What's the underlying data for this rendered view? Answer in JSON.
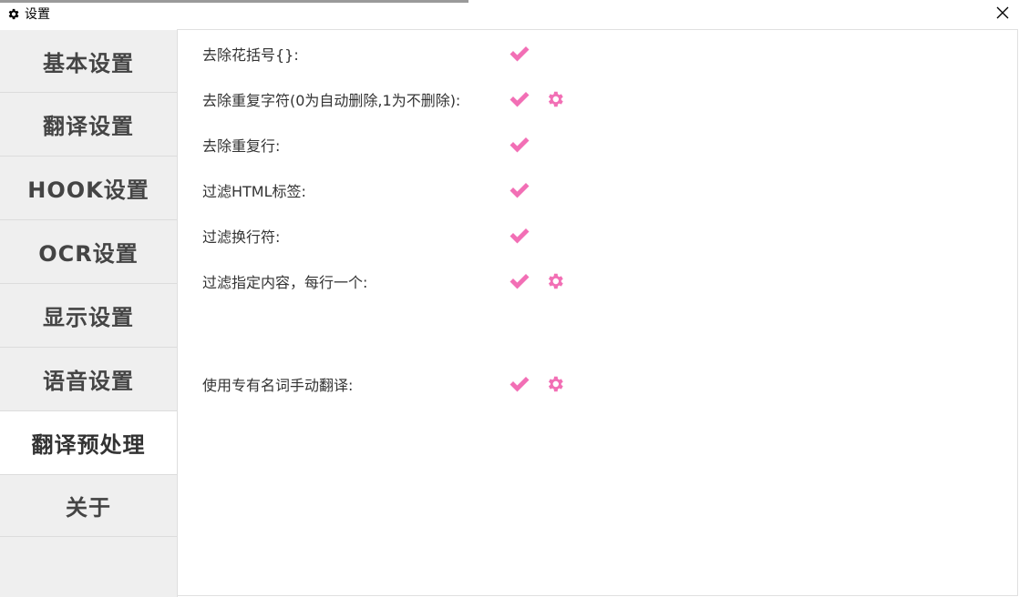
{
  "window": {
    "title": "设置",
    "title_icon": "gear-icon",
    "close_icon": "close-icon"
  },
  "sidebar": {
    "items": [
      {
        "label": "基本设置",
        "active": false
      },
      {
        "label": "翻译设置",
        "active": false
      },
      {
        "label": "HOOK设置",
        "active": false
      },
      {
        "label": "OCR设置",
        "active": false
      },
      {
        "label": "显示设置",
        "active": false
      },
      {
        "label": "语音设置",
        "active": false
      },
      {
        "label": "翻译预处理",
        "active": true
      },
      {
        "label": "关于",
        "active": false
      }
    ]
  },
  "settings": [
    {
      "label": "去除花括号{}:",
      "checked": true,
      "has_settings": false
    },
    {
      "label": "去除重复字符(0为自动删除,1为不删除):",
      "checked": true,
      "has_settings": true
    },
    {
      "label": "去除重复行:",
      "checked": true,
      "has_settings": false
    },
    {
      "label": "过滤HTML标签:",
      "checked": true,
      "has_settings": false
    },
    {
      "label": "过滤换行符:",
      "checked": true,
      "has_settings": false
    },
    {
      "label": "过滤指定内容，每行一个:",
      "checked": true,
      "has_settings": true
    },
    {
      "label": "使用专有名词手动翻译:",
      "checked": true,
      "has_settings": true
    }
  ],
  "colors": {
    "accent": "#f26fb5",
    "sidebar_bg": "#efefef",
    "active_bg": "#ffffff"
  }
}
